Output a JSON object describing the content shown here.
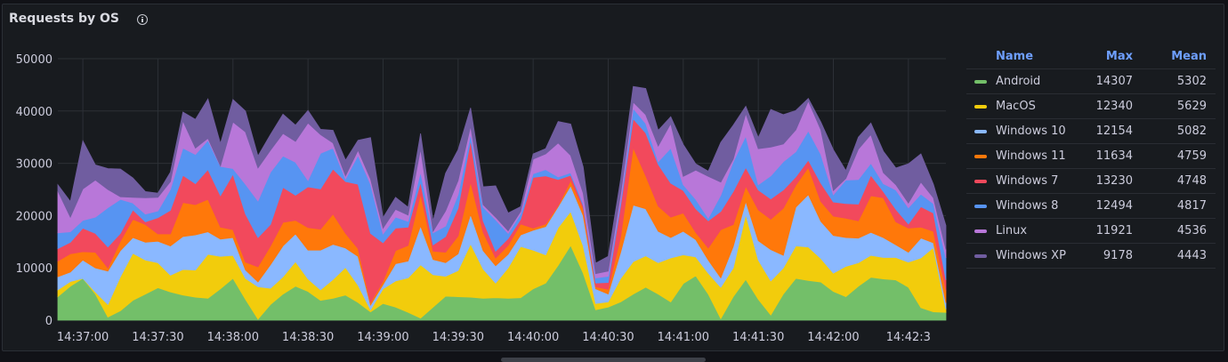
{
  "panel": {
    "title": "Requests by OS"
  },
  "legend": {
    "headers": {
      "name": "Name",
      "max": "Max",
      "mean": "Mean"
    },
    "rows": [
      {
        "name": "Android",
        "max": "14307",
        "mean": "5302",
        "color": "#73bf69"
      },
      {
        "name": "MacOS",
        "max": "12340",
        "mean": "5629",
        "color": "#f2cc0c"
      },
      {
        "name": "Windows 10",
        "max": "12154",
        "mean": "5082",
        "color": "#8ab8ff"
      },
      {
        "name": "Windows 11",
        "max": "11634",
        "mean": "4759",
        "color": "#ff780a"
      },
      {
        "name": "Windows 7",
        "max": "13230",
        "mean": "4748",
        "color": "#f2495c"
      },
      {
        "name": "Windows 8",
        "max": "12494",
        "mean": "4817",
        "color": "#5794f2"
      },
      {
        "name": "Linux",
        "max": "11921",
        "mean": "4536",
        "color": "#b877d9"
      },
      {
        "name": "Windows XP",
        "max": "9178",
        "mean": "4443",
        "color": "#705da0"
      }
    ]
  },
  "chart_data": {
    "type": "area",
    "stacked": true,
    "ylim": [
      0,
      50000
    ],
    "y_ticks": [
      "0",
      "10000",
      "20000",
      "30000",
      "40000",
      "50000"
    ],
    "x_ticks": [
      "14:37:00",
      "14:37:30",
      "14:38:00",
      "14:38:30",
      "14:39:00",
      "14:39:30",
      "14:40:00",
      "14:40:30",
      "14:41:00",
      "14:41:30",
      "14:42:00",
      "14:42:3"
    ],
    "grid": true,
    "legend_position": "right",
    "x": [
      "14:36:50",
      "14:36:55",
      "14:37:00",
      "14:37:05",
      "14:37:10",
      "14:37:15",
      "14:37:20",
      "14:37:25",
      "14:37:30",
      "14:37:35",
      "14:37:40",
      "14:37:45",
      "14:37:50",
      "14:37:55",
      "14:38:00",
      "14:38:05",
      "14:38:10",
      "14:38:15",
      "14:38:20",
      "14:38:25",
      "14:38:30",
      "14:38:35",
      "14:38:40",
      "14:38:45",
      "14:38:50",
      "14:38:55",
      "14:39:00",
      "14:39:05",
      "14:39:10",
      "14:39:15",
      "14:39:20",
      "14:39:25",
      "14:39:30",
      "14:39:35",
      "14:39:40",
      "14:39:45",
      "14:39:50",
      "14:39:55",
      "14:40:00",
      "14:40:05",
      "14:40:10",
      "14:40:15",
      "14:40:20",
      "14:40:25",
      "14:40:30",
      "14:40:35",
      "14:40:40",
      "14:40:45",
      "14:40:50",
      "14:40:55",
      "14:41:00",
      "14:41:05",
      "14:41:10",
      "14:41:15",
      "14:41:20",
      "14:41:25",
      "14:41:30",
      "14:41:35",
      "14:41:40",
      "14:41:45",
      "14:41:50",
      "14:41:55",
      "14:42:00",
      "14:42:05",
      "14:42:10",
      "14:42:15",
      "14:42:20",
      "14:42:25",
      "14:42:30",
      "14:42:35",
      "14:42:40",
      "14:42:45"
    ],
    "series": [
      {
        "name": "Android",
        "values": [
          4500,
          6500,
          8000,
          5000,
          600,
          1800,
          3800,
          5000,
          6200,
          5400,
          4800,
          4400,
          4200,
          6000,
          8000,
          4000,
          200,
          3000,
          5000,
          6500,
          5500,
          3800,
          4200,
          4800,
          3400,
          1600,
          3200,
          2500,
          1500,
          400,
          2500,
          4600,
          4500,
          4400,
          4200,
          4300,
          4200,
          4300,
          6000,
          7100,
          10500,
          14300,
          9000,
          2000,
          2500,
          3500,
          5000,
          6300,
          5000,
          3500,
          7000,
          8500,
          5000,
          300,
          4500,
          7800,
          4000,
          1000,
          5000,
          8000,
          7600,
          7300,
          5500,
          4500,
          6500,
          8200,
          7900,
          7700,
          6300,
          2400,
          1600,
          1500
        ]
      },
      {
        "name": "MacOS",
        "values": [
          1300,
          900,
          0,
          400,
          2400,
          6500,
          9000,
          6500,
          4800,
          3200,
          4900,
          5200,
          8400,
          6200,
          4400,
          4000,
          6200,
          3100,
          3300,
          4700,
          2400,
          2000,
          3600,
          5300,
          3300,
          400,
          2800,
          5000,
          6600,
          10200,
          6200,
          3800,
          5000,
          10200,
          5600,
          2800,
          5800,
          9800,
          7400,
          5400,
          7200,
          6500,
          5200,
          1200,
          1000,
          4500,
          6200,
          6000,
          6000,
          8400,
          5500,
          3600,
          4000,
          6000,
          5500,
          12400,
          7500,
          6500,
          5000,
          6200,
          6400,
          4500,
          3500,
          5800,
          4500,
          4200,
          4100,
          4300,
          4800,
          9500,
          12300,
          600
        ]
      },
      {
        "name": "Windows 10",
        "values": [
          2500,
          1800,
          3500,
          4600,
          6400,
          5000,
          3000,
          3400,
          4100,
          5600,
          6300,
          6700,
          4300,
          3300,
          3400,
          1600,
          900,
          4500,
          5900,
          5300,
          5500,
          7600,
          6700,
          3700,
          5500,
          900,
          800,
          3300,
          3200,
          7400,
          2900,
          2600,
          3200,
          5600,
          3500,
          3300,
          2600,
          2200,
          3800,
          5400,
          4000,
          4900,
          5800,
          2800,
          1500,
          5000,
          10800,
          9000,
          6000,
          3900,
          4500,
          3300,
          2500,
          1800,
          4100,
          2500,
          3700,
          6000,
          2400,
          7400,
          10000,
          7100,
          7200,
          5500,
          4700,
          4400,
          3800,
          2400,
          1900,
          3800,
          900,
          1200
        ]
      },
      {
        "name": "Windows 11",
        "values": [
          3000,
          3500,
          1600,
          3000,
          600,
          1800,
          3500,
          3400,
          1400,
          2300,
          6500,
          5800,
          6200,
          2300,
          1500,
          1500,
          2900,
          3600,
          4500,
          2600,
          4300,
          4000,
          5800,
          2800,
          1500,
          500,
          700,
          2500,
          3000,
          6100,
          1600,
          2000,
          3400,
          6200,
          3500,
          1500,
          1700,
          2100,
          400,
          500,
          200,
          1000,
          1300,
          400,
          900,
          3000,
          11000,
          6300,
          4800,
          3900,
          3500,
          1400,
          2300,
          9200,
          4200,
          2900,
          5900,
          5800,
          9000,
          4200,
          5200,
          3800,
          3700,
          3700,
          3300,
          7000,
          7600,
          4400,
          4600,
          2100,
          2200,
          2400
        ]
      },
      {
        "name": "Windows 7",
        "values": [
          2400,
          2200,
          4500,
          3600,
          4000,
          1500,
          1800,
          500,
          3100,
          4500,
          5200,
          4000,
          5700,
          6000,
          10600,
          9200,
          5600,
          4100,
          6700,
          4800,
          7800,
          7700,
          8600,
          9900,
          12300,
          13200,
          7300,
          4300,
          3500,
          2300,
          1200,
          3000,
          5300,
          8000,
          2200,
          1300,
          1300,
          900,
          9700,
          9200,
          5000,
          1000,
          600,
          700,
          1300,
          6000,
          5500,
          8200,
          8000,
          6500,
          4300,
          4500,
          5200,
          3500,
          6300,
          3600,
          3800,
          3900,
          3500,
          1600,
          1400,
          3500,
          2700,
          2800,
          3200,
          3900,
          1200,
          2400,
          800,
          3900,
          3500,
          2000
        ]
      },
      {
        "name": "Windows 8",
        "values": [
          3000,
          2000,
          1500,
          3100,
          7500,
          6500,
          1300,
          1500,
          1300,
          4000,
          5200,
          5600,
          5600,
          5600,
          1100,
          5700,
          7000,
          10000,
          6000,
          6300,
          1200,
          6800,
          4000,
          500,
          5500,
          9400,
          1700,
          2100,
          1100,
          1900,
          2300,
          2000,
          2600,
          1200,
          2600,
          6000,
          1000,
          1000,
          700,
          1200,
          500,
          500,
          400,
          1000,
          1200,
          900,
          2000,
          1800,
          500,
          6700,
          1100,
          1800,
          500,
          3100,
          5700,
          6000,
          1000,
          4400,
          5400,
          4800,
          5600,
          5500,
          1400,
          4500,
          4700,
          2300,
          1500,
          3700,
          3100,
          2400,
          1800,
          4200
        ]
      },
      {
        "name": "Linux",
        "values": [
          8000,
          2800,
          6000,
          7100,
          3500,
          500,
          1100,
          3100,
          2600,
          1500,
          5200,
          1200,
          400,
          100,
          8900,
          10000,
          6300,
          4200,
          4300,
          4000,
          11000,
          3600,
          1000,
          600,
          1000,
          1000,
          1100,
          1500,
          1200,
          4400,
          300,
          2900,
          2700,
          1500,
          500,
          500,
          500,
          500,
          2800,
          3000,
          6500,
          3300,
          2000,
          800,
          1000,
          1300,
          1200,
          1700,
          3000,
          4700,
          1600,
          5600,
          8000,
          2500,
          500,
          4300,
          6900,
          5500,
          3400,
          4200,
          5700,
          4700,
          800,
          300,
          5800,
          5500,
          2100,
          1000,
          900,
          2300,
          1100,
          1600
        ]
      },
      {
        "name": "Windows XP",
        "values": [
          1200,
          3000,
          9200,
          2900,
          4000,
          5300,
          3700,
          1200,
          800,
          1800,
          1700,
          5500,
          7500,
          4300,
          4300,
          4000,
          2300,
          3000,
          3700,
          3100,
          2400,
          1000,
          2400,
          3000,
          1900,
          7900,
          2000,
          2300,
          1500,
          3000,
          2000,
          7200,
          5900,
          3500,
          3400,
          6000,
          3400,
          900,
          1000,
          1000,
          4100,
          6000,
          5000,
          2000,
          2800,
          2800,
          3000,
          5000,
          3000,
          1300,
          6100,
          1200,
          1000,
          7600,
          6500,
          1400,
          2100,
          7200,
          5600,
          3700,
          500,
          1500,
          7800,
          1500,
          2300,
          2200,
          4100,
          3200,
          7500,
          5400,
          2600,
          4600
        ]
      }
    ]
  }
}
